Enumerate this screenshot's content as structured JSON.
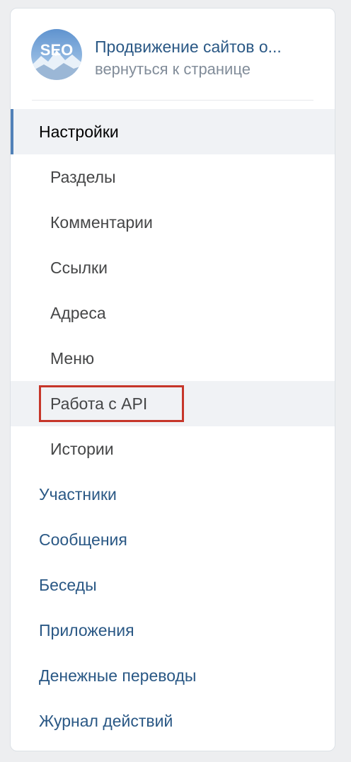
{
  "header": {
    "group_name": "Продвижение сайтов о...",
    "back_link": "вернуться к странице",
    "avatar_text": "SEO"
  },
  "menu": {
    "settings": "Настройки",
    "sub_items": [
      "Разделы",
      "Комментарии",
      "Ссылки",
      "Адреса",
      "Меню",
      "Работа с API",
      "Истории"
    ],
    "top_items": [
      "Участники",
      "Сообщения",
      "Беседы",
      "Приложения",
      "Денежные переводы",
      "Журнал действий"
    ]
  },
  "colors": {
    "link": "#2a5885",
    "sub_text": "#454647",
    "muted": "#818c99",
    "selected_bg": "#f0f2f5",
    "accent_bar": "#5181b8",
    "highlight_border": "#c6362a"
  }
}
